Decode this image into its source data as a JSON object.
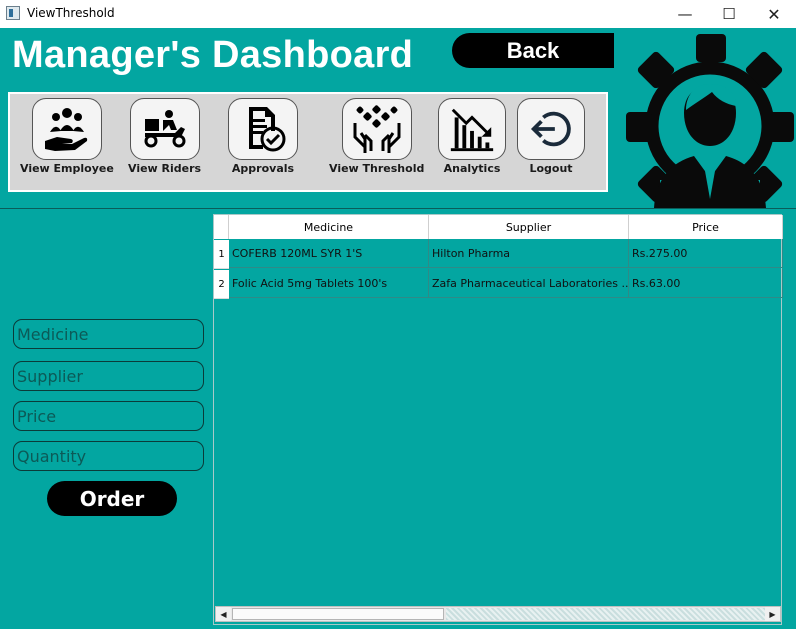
{
  "window": {
    "title": "ViewThreshold",
    "controls": {
      "minimize": "—",
      "maximize": "☐",
      "close": "✕"
    }
  },
  "header": {
    "title": "Manager's Dashboard",
    "back_label": "Back"
  },
  "colors": {
    "background": "#03a6a1",
    "button": "#000000",
    "panel": "#d6d6d6"
  },
  "nav": {
    "items": [
      {
        "label": "View Employee",
        "icon": "employees-hand-icon"
      },
      {
        "label": "View Riders",
        "icon": "delivery-rider-icon"
      },
      {
        "label": "Approvals",
        "icon": "approval-document-icon"
      },
      {
        "label": "View Threshold",
        "icon": "hands-pills-icon"
      },
      {
        "label": "Analytics",
        "icon": "declining-chart-icon"
      },
      {
        "label": "Logout",
        "icon": "logout-arrow-icon"
      }
    ]
  },
  "form": {
    "medicine_placeholder": "Medicine",
    "supplier_placeholder": "Supplier",
    "price_placeholder": "Price",
    "quantity_placeholder": "Quantity",
    "order_label": "Order"
  },
  "table": {
    "columns": [
      "Medicine",
      "Supplier",
      "Price"
    ],
    "rows": [
      {
        "num": "1",
        "medicine": "COFERB 120ML SYR 1'S",
        "supplier": "Hilton Pharma",
        "price": "Rs.275.00"
      },
      {
        "num": "2",
        "medicine": "Folic Acid 5mg Tablets 100's",
        "supplier": "Zafa Pharmaceutical Laboratories ...",
        "price": "Rs.63.00"
      }
    ]
  },
  "scrollbar": {
    "left_arrow": "◀",
    "right_arrow": "▶"
  }
}
